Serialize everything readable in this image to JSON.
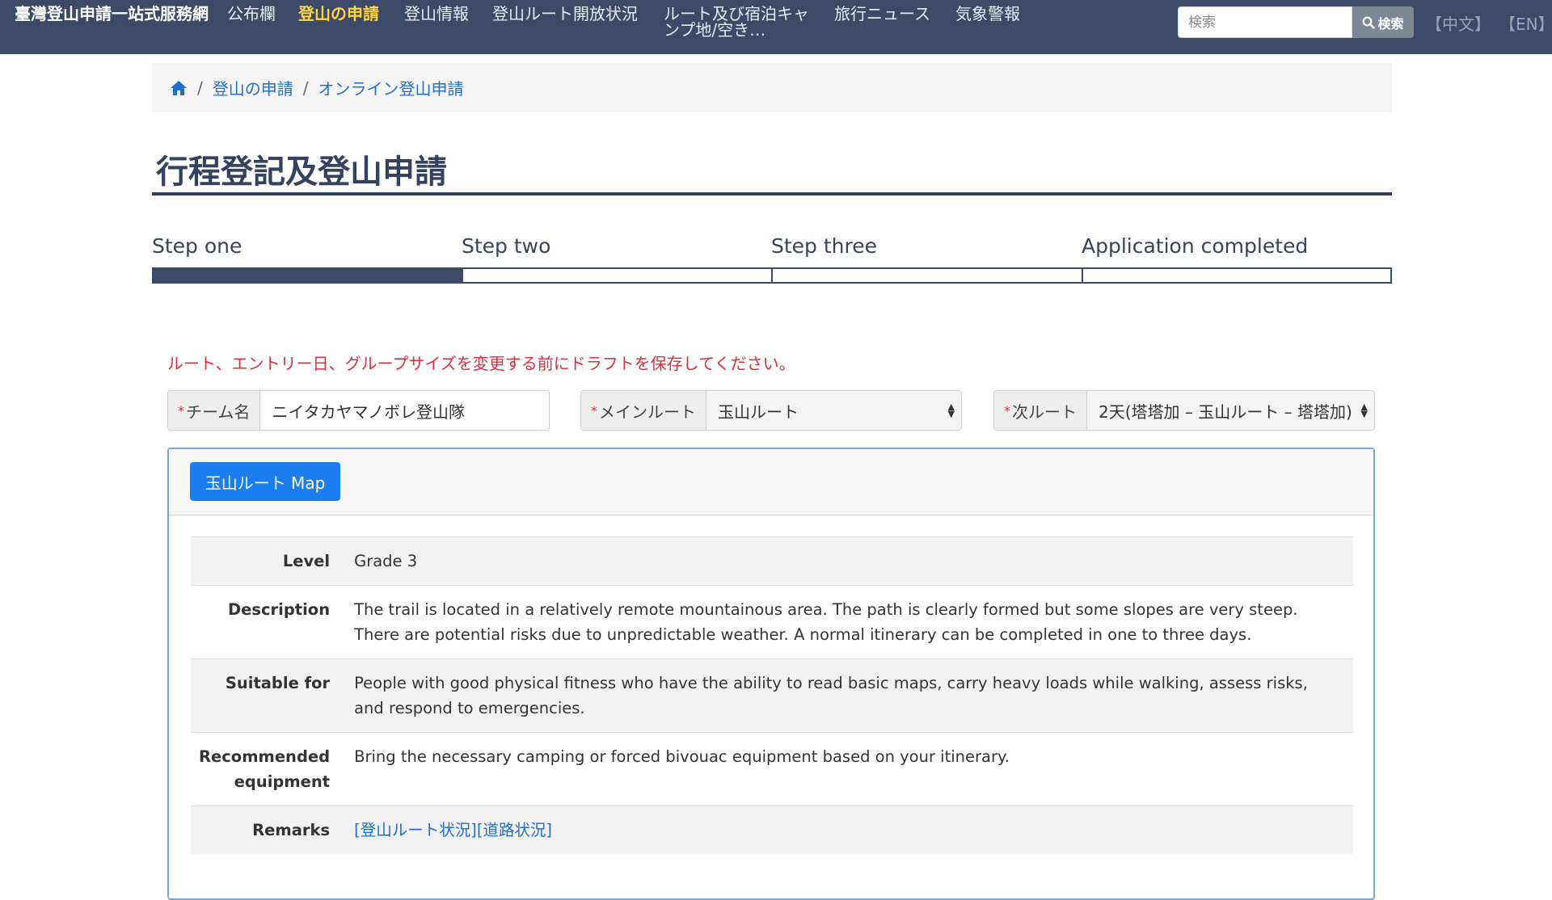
{
  "navbar": {
    "brand": "臺灣登山申請一站式服務網",
    "items": [
      {
        "label": "公布欄",
        "active": false
      },
      {
        "label": "登山の申請",
        "active": true
      },
      {
        "label": "登山情報",
        "active": false
      },
      {
        "label": "登山ルート開放状況",
        "active": false
      },
      {
        "label": "ルート及び宿泊キャンプ地/空き…",
        "active": false
      },
      {
        "label": "旅行ニュース",
        "active": false
      },
      {
        "label": "気象警報",
        "active": false
      }
    ],
    "search_placeholder": "検索",
    "search_button": "検索",
    "lang_zh": "【中文】",
    "lang_en": "【EN】"
  },
  "breadcrumb": {
    "items": [
      "登山の申請",
      "オンライン登山申請"
    ]
  },
  "page_title": "行程登記及登山申請",
  "steps": {
    "labels": [
      "Step one",
      "Step two",
      "Step three",
      "Application completed"
    ],
    "current": 1
  },
  "warning": "ルート、エントリー日、グループサイズを変更する前にドラフトを保存してください。",
  "form": {
    "team_name": {
      "label": "チーム名",
      "value": "ニイタカヤマノボレ登山隊"
    },
    "main_route": {
      "label": "メインルート",
      "value": "玉山ルート"
    },
    "sub_route": {
      "label": "次ルート",
      "value": "2天(塔塔加 – 玉山ルート – 塔塔加)"
    }
  },
  "panel": {
    "map_button": "玉山ルート Map",
    "rows": [
      {
        "label": "Level",
        "value": "Grade 3"
      },
      {
        "label": "Description",
        "value": "The trail is located in a relatively remote mountainous area. The path is clearly formed but some slopes are very steep. There are potential risks due to unpredictable weather. A normal itinerary can be completed in one to three days."
      },
      {
        "label": "Suitable for",
        "value": "People with good physical fitness who have the ability to read basic maps, carry heavy loads while walking, assess risks, and respond to emergencies."
      },
      {
        "label": "Recommended equipment",
        "value": "Bring the necessary camping or forced bivouac equipment based on your itinerary."
      },
      {
        "label": "Remarks",
        "links": [
          "[登山ルート状況]",
          "[道路状況]"
        ]
      }
    ]
  },
  "colors": {
    "navbar": "#3c4a68",
    "nav_active": "#ffd63a",
    "link": "#1f6fd0",
    "warning": "#d9303f",
    "primary_button": "#1a7ef2"
  }
}
